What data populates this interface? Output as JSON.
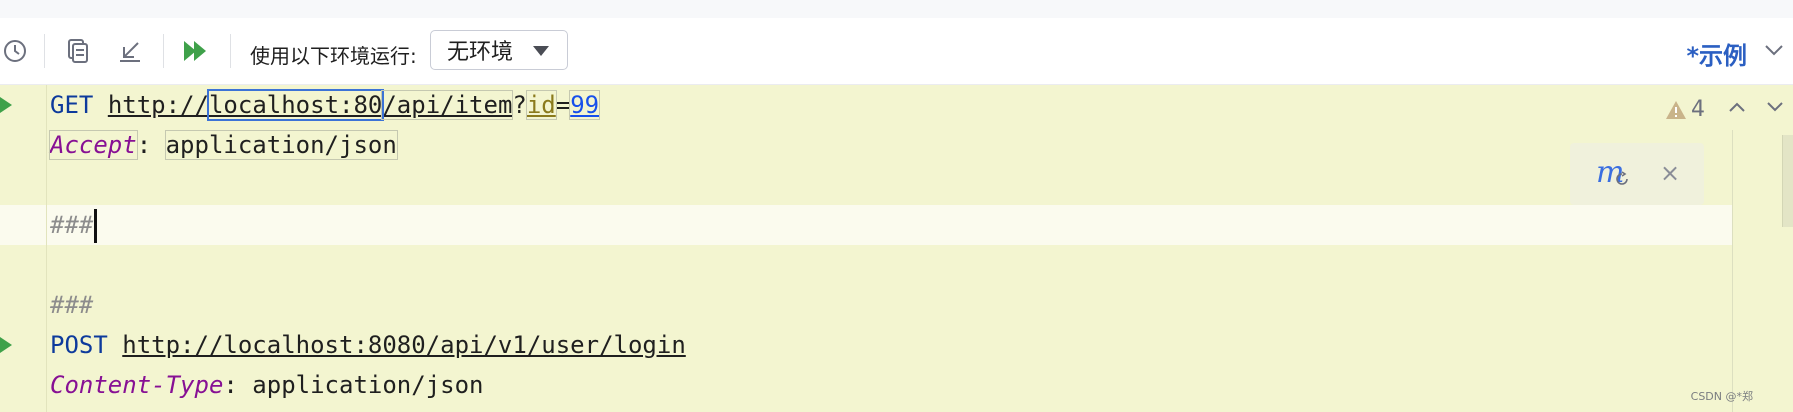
{
  "toolbar": {
    "icons": [
      "history-icon",
      "copy-icon",
      "collapse-icon",
      "run-all-icon"
    ],
    "env_label": "使用以下环境运行:",
    "env_value": "无环境",
    "example_label": "*示例"
  },
  "editor": {
    "request1": {
      "method": "GET",
      "url_scheme": "http://",
      "url_host": "localhost:80",
      "url_path": "/api/item",
      "url_query_sep": "?",
      "param_name": "id",
      "param_eq": "=",
      "param_value": "99",
      "header_name": "Accept",
      "header_colon": ": ",
      "header_value": "application/json"
    },
    "separator1": "###",
    "separator2": "###",
    "request2": {
      "method": "POST",
      "url": "http://localhost:8080/api/v1/user/login",
      "header_name": "Content-Type",
      "header_colon": ": ",
      "header_value": "application/json"
    },
    "inspection_count": "4",
    "popup_close": "×"
  },
  "watermark": "CSDN @*郑"
}
